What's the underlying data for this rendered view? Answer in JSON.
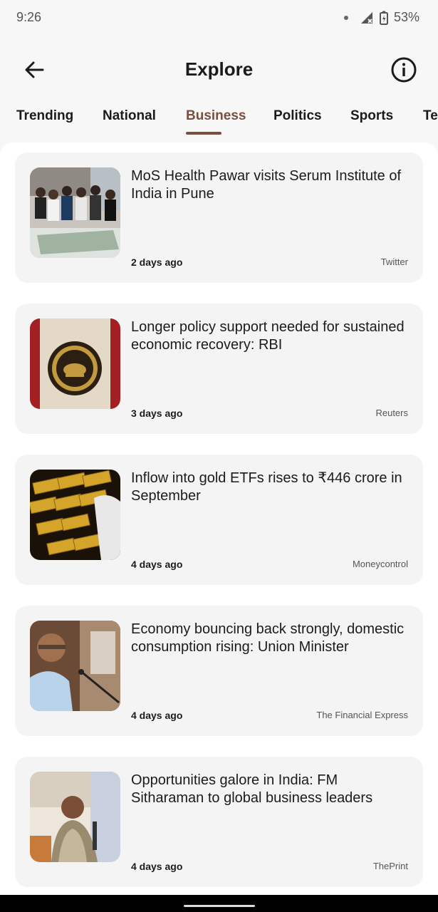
{
  "status": {
    "time": "9:26",
    "battery": "53%"
  },
  "header": {
    "title": "Explore"
  },
  "tabs": [
    {
      "label": "Trending"
    },
    {
      "label": "National"
    },
    {
      "label": "Business"
    },
    {
      "label": "Politics"
    },
    {
      "label": "Sports"
    },
    {
      "label": "Te"
    }
  ],
  "active_tab": "Business",
  "articles": [
    {
      "headline": "MoS Health Pawar visits Serum Institute of India in Pune",
      "time": "2 days ago",
      "source": "Twitter"
    },
    {
      "headline": "Longer policy support needed for sustained economic recovery: RBI",
      "time": "3 days ago",
      "source": "Reuters"
    },
    {
      "headline": "Inflow into gold ETFs rises to ₹446 crore in September",
      "time": "4 days ago",
      "source": "Moneycontrol"
    },
    {
      "headline": "Economy bouncing back strongly, domestic consumption rising: Union Minister",
      "time": "4 days ago",
      "source": "The Financial Express"
    },
    {
      "headline": "Opportunities galore in India: FM Sitharaman to global business leaders",
      "time": "4 days ago",
      "source": "ThePrint"
    }
  ],
  "colors": {
    "accent": "#7a4f3f",
    "card": "#f4f4f4",
    "background": "#f7f7f7"
  }
}
